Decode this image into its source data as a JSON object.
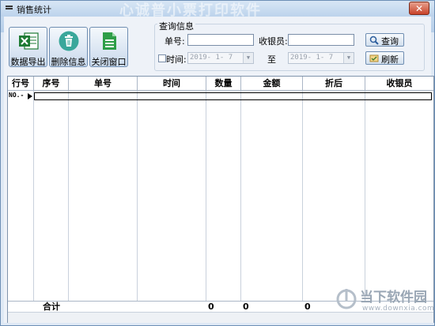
{
  "window": {
    "title": "销售统计",
    "title_watermark": "心诚普小票打印软件",
    "close_label": "✕"
  },
  "toolbar": {
    "export_label": "数据导出",
    "delete_label": "删除信息",
    "close_label": "关闭窗口"
  },
  "query": {
    "group_title": "查询信息",
    "order_no_label": "单号:",
    "order_no_value": "",
    "cashier_label": "收银员:",
    "cashier_value": "",
    "time_label": "时间:",
    "time_checked": false,
    "date_from": "2019- 1- 7",
    "to_label": "至",
    "date_to": "2019- 1- 7",
    "search_label": "查询",
    "refresh_label": "刷新"
  },
  "grid": {
    "columns": [
      "行号",
      "序号",
      "单号",
      "时间",
      "数量",
      "金额",
      "折后",
      "收银员"
    ],
    "first_row_header": "NO.-",
    "footer": {
      "label": "合计",
      "quantity": "0",
      "amount": "0",
      "discounted": "0"
    }
  },
  "watermark": {
    "text": "当下软件园",
    "url": "www.downxia.com"
  },
  "colors": {
    "excel_green": "#1e7b34",
    "delete_teal": "#3aa79b",
    "close_green": "#2e9e48",
    "close_red": "#c9432a"
  }
}
